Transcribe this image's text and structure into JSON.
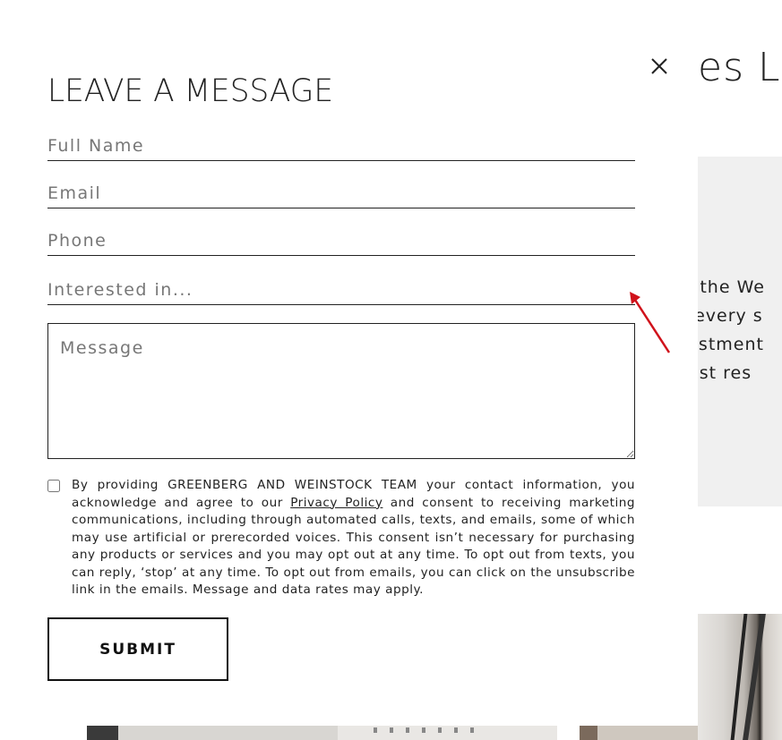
{
  "background": {
    "heading": "es L",
    "text_lines": [
      "in the We",
      "n every s",
      "vestment",
      "best res"
    ]
  },
  "modal": {
    "title": "LEAVE A MESSAGE",
    "fields": {
      "full_name_placeholder": "Full Name",
      "email_placeholder": "Email",
      "phone_placeholder": "Phone",
      "interested_placeholder": "Interested in...",
      "message_placeholder": "Message"
    },
    "consent": {
      "before_link": "By providing GREENBERG AND WEINSTOCK TEAM your contact information, you acknowledge and agree to our ",
      "link_text": "Privacy Policy",
      "after_link": " and consent to receiving marketing communications, including through automated calls, texts, and emails, some of which may use artificial or prerecorded voices. This consent isn’t necessary for purchasing any products or services and you may opt out at any time. To opt out from texts, you can reply, ‘stop’ at any time. To opt out from emails, you can click on the unsubscribe link in the emails. Message and data rates may apply."
    },
    "submit_label": "SUBMIT"
  },
  "icons": {
    "close": "close-icon",
    "annotation": "red-arrow-icon"
  },
  "colors": {
    "annotation_arrow": "#d0121b",
    "text": "#222222",
    "panel_gray": "#f0f0f0"
  }
}
